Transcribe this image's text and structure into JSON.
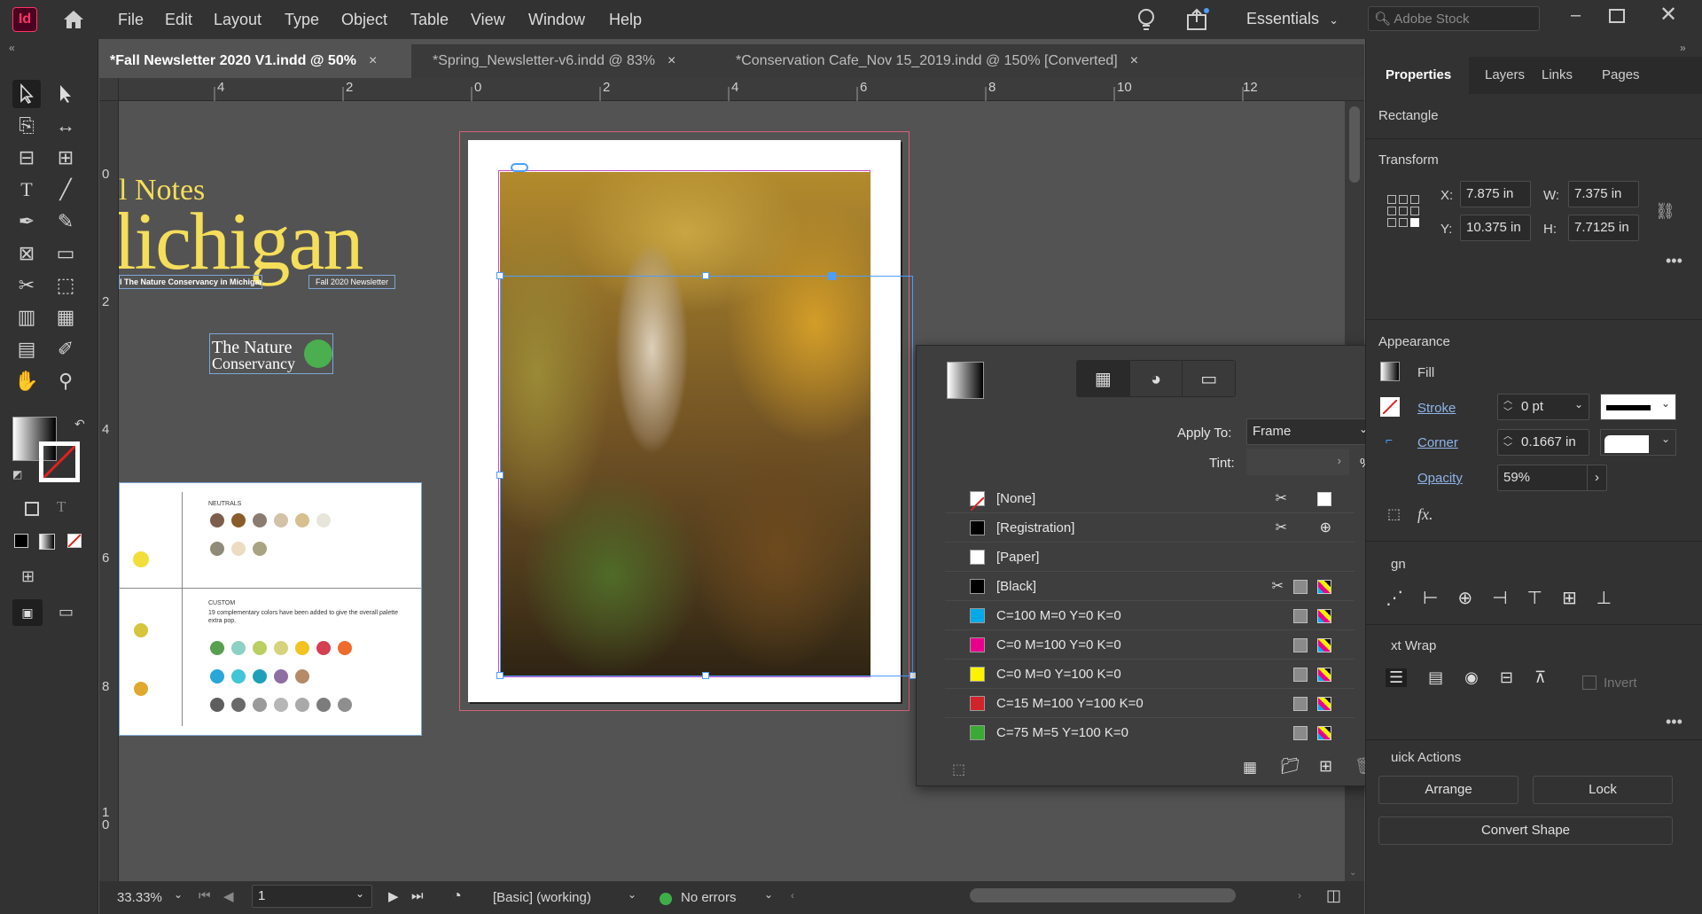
{
  "app": {
    "logo": "Id"
  },
  "menu": [
    "File",
    "Edit",
    "Layout",
    "Type",
    "Object",
    "Table",
    "View",
    "Window",
    "Help"
  ],
  "workspace": "Essentials",
  "search": {
    "placeholder": "Adobe Stock"
  },
  "tabs": [
    {
      "label": "*Fall Newsletter 2020 V1.indd @ 50%",
      "active": true
    },
    {
      "label": "*Spring_Newsletter-v6.indd @ 83%",
      "active": false
    },
    {
      "label": "*Conservation Cafe_Nov 15_2019.indd @ 150% [Converted]",
      "active": false
    }
  ],
  "tab_close": "×",
  "ruler": {
    "h": [
      "4",
      "2",
      "0",
      "2",
      "4",
      "6",
      "8",
      "10",
      "12"
    ],
    "v": [
      "0",
      "2",
      "4",
      "6",
      "8",
      "1 0"
    ]
  },
  "page_content": {
    "headline_small": "l Notes",
    "headline_big": "lichigan",
    "tagline_left": "l The Nature Conservancy in Michigan",
    "tagline_right": "Fall 2020 Newsletter",
    "logo_text_1": "The Nature",
    "logo_text_2": "Conservancy",
    "palette_neutrals": "NEUTRALS",
    "palette_custom": "CUSTOM",
    "palette_custom_desc": "19 complementary colors have been added to give the overall palette extra pop."
  },
  "status": {
    "zoom": "33.33%",
    "page": "1",
    "style": "[Basic] (working)",
    "errors": "No errors"
  },
  "properties": {
    "tabs": [
      "Properties",
      "Layers",
      "Links",
      "Pages"
    ],
    "object_type": "Rectangle",
    "transform_title": "Transform",
    "x_label": "X:",
    "x": "7.875 in",
    "y_label": "Y:",
    "y": "10.375 in",
    "w_label": "W:",
    "w": "7.375 in",
    "h_label": "H:",
    "h": "7.7125 in",
    "appearance_title": "Appearance",
    "fill_label": "Fill",
    "stroke_label": "Stroke",
    "stroke_value": "0 pt",
    "corner_label": "Corner",
    "corner_value": "0.1667 in",
    "opacity_label": "Opacity",
    "opacity_value": "59%",
    "fx": "fx.",
    "align_title": "gn",
    "text_wrap_title": "xt Wrap",
    "invert_label": "Invert",
    "quick_actions_title": "uick Actions",
    "arrange": "Arrange",
    "lock": "Lock",
    "convert_shape": "Convert Shape"
  },
  "swatch_panel": {
    "apply_to_label": "Apply To:",
    "apply_to_value": "Frame",
    "tint_label": "Tint:",
    "tint_unit": "%",
    "swatches": [
      {
        "name": "[None]",
        "color": "none"
      },
      {
        "name": "[Registration]",
        "color": "#000000"
      },
      {
        "name": "[Paper]",
        "color": "#ffffff"
      },
      {
        "name": "[Black]",
        "color": "#000000"
      },
      {
        "name": "C=100 M=0 Y=0 K=0",
        "color": "#00a9e8"
      },
      {
        "name": "C=0 M=100 Y=0 K=0",
        "color": "#e8008a"
      },
      {
        "name": "C=0 M=0 Y=100 K=0",
        "color": "#fff200"
      },
      {
        "name": "C=15 M=100 Y=100 K=0",
        "color": "#d2232a"
      },
      {
        "name": "C=75 M=5 Y=100 K=0",
        "color": "#3aaa35"
      }
    ]
  },
  "colors": {
    "accent_blue": "#4c9eff",
    "headline_yellow": "#f5de5a",
    "status_ok": "#3fae49"
  }
}
